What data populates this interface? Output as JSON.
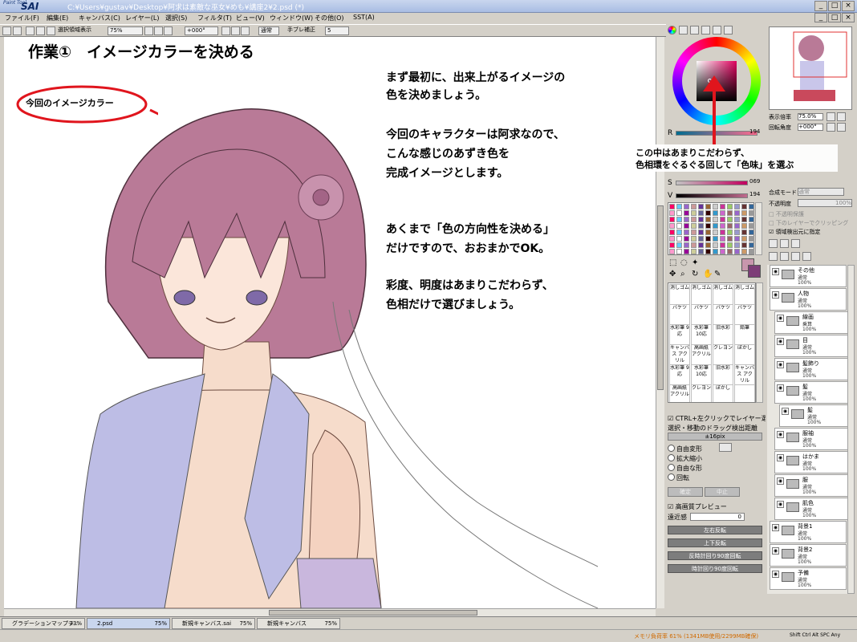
{
  "titlebar": {
    "logo_small": "Paint Tool",
    "logo_big": "SAI",
    "path": "C:¥Users¥gustav¥Desktop¥阿求は素敵な巫女¥めも¥講座2¥2.psd (*)"
  },
  "menu": [
    "ファイル(F)",
    "編集(E)",
    "キャンバス(C)",
    "レイヤー(L)",
    "選択(S)",
    "フィルタ(T)",
    "ビュー(V)",
    "ウィンドウ(W)",
    "その他(O)",
    "SST(A)"
  ],
  "toolbar": {
    "selection_show": "選択領域表示",
    "zoom": "75%",
    "angle": "+000°",
    "blend": "通常",
    "stabilizer_label": "手ブレ補正",
    "stabilizer_value": "5"
  },
  "canvas": {
    "heading": "作業①　イメージカラーを決める",
    "bubble": "今回のイメージカラー",
    "para1": [
      "まず最初に、出来上がるイメージの",
      "色を決めましょう。"
    ],
    "para2": [
      "今回のキャラクターは阿求なので、",
      "こんな感じのあずき色を",
      "完成イメージとします。"
    ],
    "para3": [
      "あくまで「色の方向性を決める」",
      "だけですので、おおまかでOK。"
    ],
    "para4": [
      "彩度、明度はあまりこだわらず、",
      "色相だけで選びましょう。"
    ],
    "callout": [
      "この中はあまりこだわらず、",
      "色相環をぐるぐる回して「色味」を選ぶ"
    ]
  },
  "color_panel": {
    "r_label": "R",
    "r_value": "194",
    "s_label": "S",
    "s_value": "069",
    "v_label": "V",
    "v_value": "194",
    "accent": "#c26c8f",
    "tools": [
      "消しゴム",
      "消しゴム",
      "消しゴム",
      "消しゴム",
      "バケツ",
      "バケツ",
      "バケツ",
      "バケツ",
      "水彩筆 9応",
      "水彩筆 10応",
      "旧水彩",
      "鉛筆",
      "キャンバス アクリル",
      "高画紙 アクリル",
      "クレヨン",
      "ぼかし",
      "水彩筆 9応",
      "水彩筆 10応",
      "旧水彩",
      "キャンバス アクリル",
      "高画紙 アクリル",
      "クレヨン",
      "ぼかし",
      ""
    ],
    "ctrl_select": "CTRL+左クリックでレイヤー選択",
    "drag_label": "選択・移動のドラッグ検出距離",
    "drag_value": "±16pix",
    "transform_options": [
      "自由変形",
      "拡大縮小",
      "自由な形",
      "回転"
    ],
    "ok_label": "確定",
    "cancel_label": "中止",
    "preview_label": "高画質プレビュー",
    "perspective_label": "遠近感",
    "perspective_value": "0",
    "flip_h": "左右反転",
    "flip_v": "上下反転",
    "rot_ccw": "反時計回り90度回転",
    "rot_cw": "時計回り90度回転"
  },
  "navigator": {
    "zoom_label": "表示倍率",
    "zoom_value": "75.0%",
    "angle_label": "回転角度",
    "angle_value": "+000°"
  },
  "layer_panel": {
    "blend_label": "合成モード",
    "blend_value": "通常",
    "opacity_label": "不透明度",
    "opacity_value": "100%",
    "protect": "不透明保護",
    "clip": "下のレイヤーでクリッピング",
    "select_src": "領域検出元に指定",
    "layers": [
      {
        "name": "その他",
        "mode": "通常",
        "op": "100%"
      },
      {
        "name": "人物",
        "mode": "通常",
        "op": "100%"
      },
      {
        "name": "線画",
        "mode": "乗算",
        "op": "100%"
      },
      {
        "name": "目",
        "mode": "通常",
        "op": "100%"
      },
      {
        "name": "髪飾り",
        "mode": "通常",
        "op": "100%"
      },
      {
        "name": "髪",
        "mode": "通常",
        "op": "100%"
      },
      {
        "name": "髪",
        "mode": "通常",
        "op": "100%"
      },
      {
        "name": "服袖",
        "mode": "通常",
        "op": "100%"
      },
      {
        "name": "はかま",
        "mode": "通常",
        "op": "100%"
      },
      {
        "name": "服",
        "mode": "通常",
        "op": "100%"
      },
      {
        "name": "肌色",
        "mode": "通常",
        "op": "100%"
      },
      {
        "name": "背景1",
        "mode": "通常",
        "op": "100%"
      },
      {
        "name": "背景2",
        "mode": "通常",
        "op": "100%"
      },
      {
        "name": "予備",
        "mode": "通常",
        "op": "100%"
      }
    ]
  },
  "tabs": [
    {
      "name": "グラデーションマップテ...",
      "pct": "33%"
    },
    {
      "name": "2.psd",
      "pct": "75%"
    },
    {
      "name": "新規キャンバス.sai",
      "pct": "75%"
    },
    {
      "name": "新規キャンバス",
      "pct": "75%"
    }
  ],
  "status": {
    "memory": "メモリ負荷率 61% (1341MB使用/2299MB確保)",
    "keys": "Shift Ctrl Alt SPC Any"
  }
}
